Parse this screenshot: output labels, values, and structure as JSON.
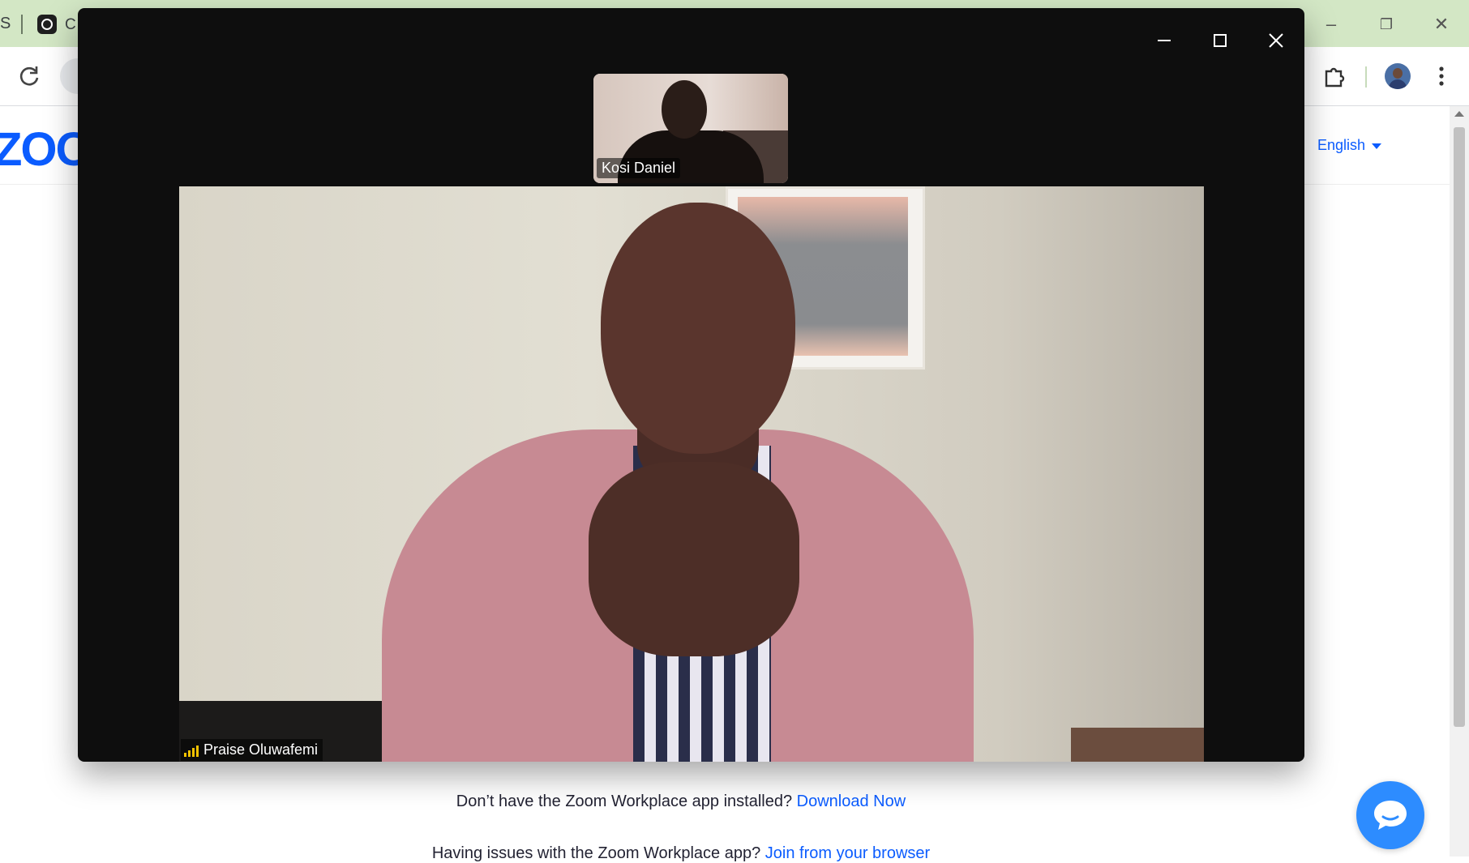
{
  "browser": {
    "tab_fragment_left": "S",
    "tab_fragment_active": "C",
    "window_controls": {
      "minimize": "–",
      "restore": "❐",
      "close": "✕"
    }
  },
  "page": {
    "logo_text": "ZOO",
    "language": "English",
    "download_prompt": "Don’t have the Zoom Workplace app installed?",
    "download_link": "Download Now",
    "issue_prompt": "Having issues with the Zoom Workplace app?",
    "issue_link": "Join from your browser"
  },
  "meeting": {
    "thumbnail_participant": "Kosi Daniel",
    "main_participant": "Praise Oluwafemi",
    "accent_color": "#f2c200"
  }
}
